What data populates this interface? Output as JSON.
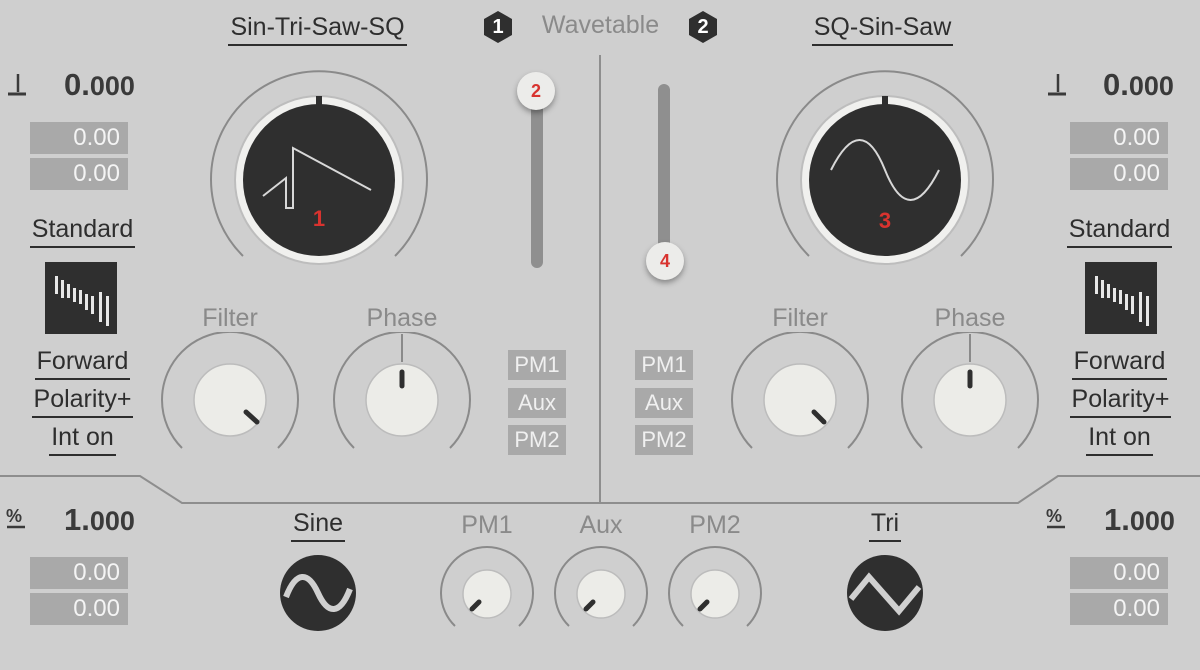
{
  "header": {
    "osc1_name": "Sin-Tri-Saw-SQ",
    "center_title": "Wavetable",
    "osc1_badge": "1",
    "osc2_badge": "2",
    "osc2_name": "SQ-Sin-Saw"
  },
  "left": {
    "pitch_value_int": "0.",
    "pitch_value_dec": "000",
    "pitch_box1": "0.00",
    "pitch_box2": "0.00",
    "mode": "Standard",
    "direction": "Forward",
    "polarity": "Polarity+",
    "interp": "Int on",
    "percent_value_int": "1.",
    "percent_value_dec": "000",
    "percent_box1": "0.00",
    "percent_box2": "0.00"
  },
  "right": {
    "pitch_value_int": "0.",
    "pitch_value_dec": "000",
    "pitch_box1": "0.00",
    "pitch_box2": "0.00",
    "mode": "Standard",
    "direction": "Forward",
    "polarity": "Polarity+",
    "interp": "Int on",
    "percent_value_int": "1.",
    "percent_value_dec": "000",
    "percent_box1": "0.00",
    "percent_box2": "0.00"
  },
  "osc1": {
    "wave_knob_number": "1",
    "slider_number": "2",
    "filter_label": "Filter",
    "phase_label": "Phase",
    "tags": [
      "PM1",
      "Aux",
      "PM2"
    ]
  },
  "osc2": {
    "wave_knob_number": "3",
    "slider_number": "4",
    "filter_label": "Filter",
    "phase_label": "Phase",
    "tags": [
      "PM1",
      "Aux",
      "PM2"
    ]
  },
  "bottom": {
    "lfo1_shape": "Sine",
    "lfo2_shape": "Tri",
    "pm1_label": "PM1",
    "aux_label": "Aux",
    "pm2_label": "PM2"
  },
  "icons": {
    "note": "quarter-note-icon",
    "percent": "percent-icon",
    "mode_graphic": "step-bars-icon"
  },
  "colors": {
    "background": "#cfcfcf",
    "knob_dark": "#2f2f2f",
    "knob_light": "#e8e8e6",
    "accent_red": "#d8332f",
    "box_gray": "#a9a9a9"
  }
}
